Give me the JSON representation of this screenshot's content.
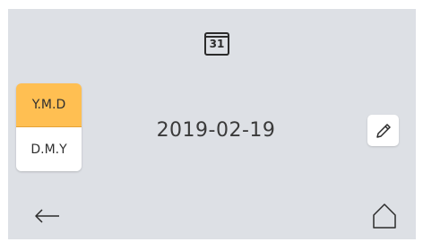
{
  "header": {
    "calendar_icon": "calendar-icon",
    "calendar_day": "31"
  },
  "date_format": {
    "options": [
      "Y.M.D",
      "D.M.Y"
    ],
    "selected": "Y.M.D",
    "active_color": "#ffbf52"
  },
  "date": {
    "value": "2019-02-19"
  },
  "actions": {
    "edit_icon": "pencil-icon",
    "back_icon": "arrow-left-icon",
    "home_icon": "home-icon"
  },
  "colors": {
    "background": "#dde0e5",
    "button": "#ffffff",
    "text": "#3a3a3a"
  }
}
